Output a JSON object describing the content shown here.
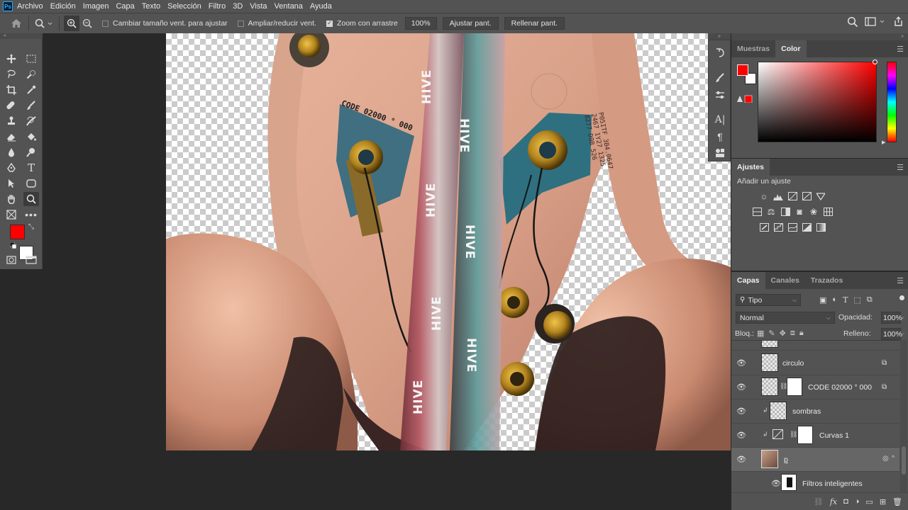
{
  "menu": [
    "Archivo",
    "Edición",
    "Imagen",
    "Capa",
    "Texto",
    "Selección",
    "Filtro",
    "3D",
    "Vista",
    "Ventana",
    "Ayuda"
  ],
  "app_logo": "Ps",
  "options": {
    "resize_windows": "Cambiar tamaño vent. para ajustar",
    "resize_checked": false,
    "zoom_all": "Ampliar/reducir vent.",
    "zoom_all_checked": false,
    "scrubby_zoom": "Zoom con arrastre",
    "scrubby_checked": true,
    "zoom_value": "100%",
    "fit_screen": "Ajustar pant.",
    "fill_screen": "Rellenar pant."
  },
  "colors": {
    "foreground": "#ff0000",
    "background": "#ffffff",
    "accent": "#31a8ff"
  },
  "color_panel": {
    "tab_swatches": "Muestras",
    "tab_color": "Color"
  },
  "adjustments_panel": {
    "title": "Ajustes",
    "add_label": "Añadir un ajuste"
  },
  "layers_panel": {
    "tab_layers": "Capas",
    "tab_channels": "Canales",
    "tab_paths": "Trazados",
    "filter_kind": "Tipo",
    "blend_mode": "Normal",
    "opacity_label": "Opacidad:",
    "opacity_value": "100%",
    "lock_label": "Bloq.:",
    "fill_label": "Relleno:",
    "fill_value": "100%",
    "layers": [
      {
        "name": "circulo"
      },
      {
        "name": "CODE 02000 ° 000"
      },
      {
        "name": "sombras"
      },
      {
        "name": "Curvas 1"
      },
      {
        "name": "p"
      },
      {
        "name": "Filtros inteligentes"
      }
    ]
  },
  "canvas_text": {
    "code": "CODE 02000 ° 000",
    "brand": "HIVE"
  }
}
